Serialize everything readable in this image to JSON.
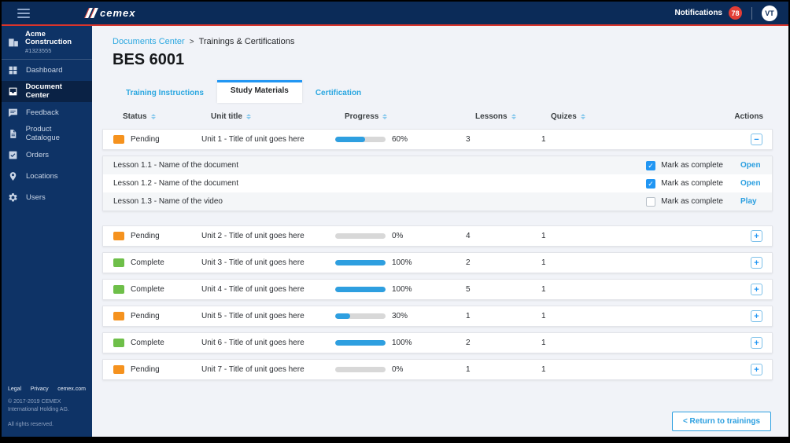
{
  "topbar": {
    "logo_text": "cemex",
    "notifications_label": "Notifications",
    "notifications_count": "78",
    "avatar_initials": "VT"
  },
  "sidebar": {
    "company": {
      "name": "Acme Construction",
      "number": "#1323555",
      "icon": "building-icon"
    },
    "items": [
      {
        "label": "Dashboard",
        "icon": "dashboard-grid-icon",
        "active": false
      },
      {
        "label": "Document Center",
        "icon": "inbox-icon",
        "active": true
      },
      {
        "label": "Feedback",
        "icon": "chat-bubble-icon",
        "active": false
      },
      {
        "label": "Product Catalogue",
        "icon": "document-page-icon",
        "active": false
      },
      {
        "label": "Orders",
        "icon": "checkbox-icon",
        "active": false
      },
      {
        "label": "Locations",
        "icon": "map-pin-icon",
        "active": false
      },
      {
        "label": "Users",
        "icon": "gear-icon",
        "active": false
      }
    ],
    "footer_links": [
      "Legal",
      "Privacy",
      "cemex.com"
    ],
    "copyright_lines": [
      "© 2017-2019 CEMEX",
      "International Holding AG.",
      "All rights reserved."
    ]
  },
  "main": {
    "breadcrumb": {
      "parent": "Documents Center",
      "separator": ">",
      "current": "Trainings & Certifications"
    },
    "title": "BES 6001",
    "tabs": [
      {
        "label": "Training Instructions",
        "active": false
      },
      {
        "label": "Study Materials",
        "active": true
      },
      {
        "label": "Certification",
        "active": false
      }
    ],
    "table": {
      "headers": [
        {
          "label": "Status",
          "sortable": true
        },
        {
          "label": "Unit title",
          "sortable": true
        },
        {
          "label": "Progress",
          "sortable": true
        },
        {
          "label": "Lessons",
          "sortable": true
        },
        {
          "label": "Quizes",
          "sortable": true
        },
        {
          "label": "Actions",
          "sortable": false
        }
      ],
      "rows": [
        {
          "status": "Pending",
          "status_color": "orange",
          "unit_title": "Unit 1 - Title of unit goes here",
          "progress_pct": 60,
          "progress_label": "60%",
          "lessons": "3",
          "quizes": "1",
          "expanded": true,
          "sub_lessons": [
            {
              "title": "Lesson 1.1 - Name of the document",
              "checkbox_label": "Mark as complete",
              "checked": true,
              "link": "Open"
            },
            {
              "title": "Lesson 1.2 - Name of the document",
              "checkbox_label": "Mark as complete",
              "checked": true,
              "link": "Open"
            },
            {
              "title": "Lesson 1.3 - Name of the video",
              "checkbox_label": "Mark as complete",
              "checked": false,
              "link": "Play"
            }
          ]
        },
        {
          "status": "Pending",
          "status_color": "orange",
          "unit_title": "Unit 2 - Title of unit goes here",
          "progress_pct": 0,
          "progress_label": "0%",
          "lessons": "4",
          "quizes": "1",
          "expanded": false
        },
        {
          "status": "Complete",
          "status_color": "green",
          "unit_title": "Unit 3 - Title of unit goes here",
          "progress_pct": 100,
          "progress_label": "100%",
          "lessons": "2",
          "quizes": "1",
          "expanded": false
        },
        {
          "status": "Complete",
          "status_color": "green",
          "unit_title": "Unit 4 - Title of unit goes here",
          "progress_pct": 100,
          "progress_label": "100%",
          "lessons": "5",
          "quizes": "1",
          "expanded": false
        },
        {
          "status": "Pending",
          "status_color": "orange",
          "unit_title": "Unit 5 - Title of unit goes here",
          "progress_pct": 30,
          "progress_label": "30%",
          "lessons": "1",
          "quizes": "1",
          "expanded": false
        },
        {
          "status": "Complete",
          "status_color": "green",
          "unit_title": "Unit 6 - Title of unit goes here",
          "progress_pct": 100,
          "progress_label": "100%",
          "lessons": "2",
          "quizes": "1",
          "expanded": false
        },
        {
          "status": "Pending",
          "status_color": "orange",
          "unit_title": "Unit 7 - Title of unit goes here",
          "progress_pct": 0,
          "progress_label": "0%",
          "lessons": "1",
          "quizes": "1",
          "expanded": false
        }
      ]
    },
    "return_button": "< Return to trainings"
  },
  "colors": {
    "navy": "#0b2b58",
    "sidebar_navy": "#0e3366",
    "red_accent": "#d9342b",
    "link_blue": "#2b9fe0",
    "progress_blue": "#2e9fe0",
    "pending_orange": "#f5921e",
    "complete_green": "#6ebf49"
  }
}
